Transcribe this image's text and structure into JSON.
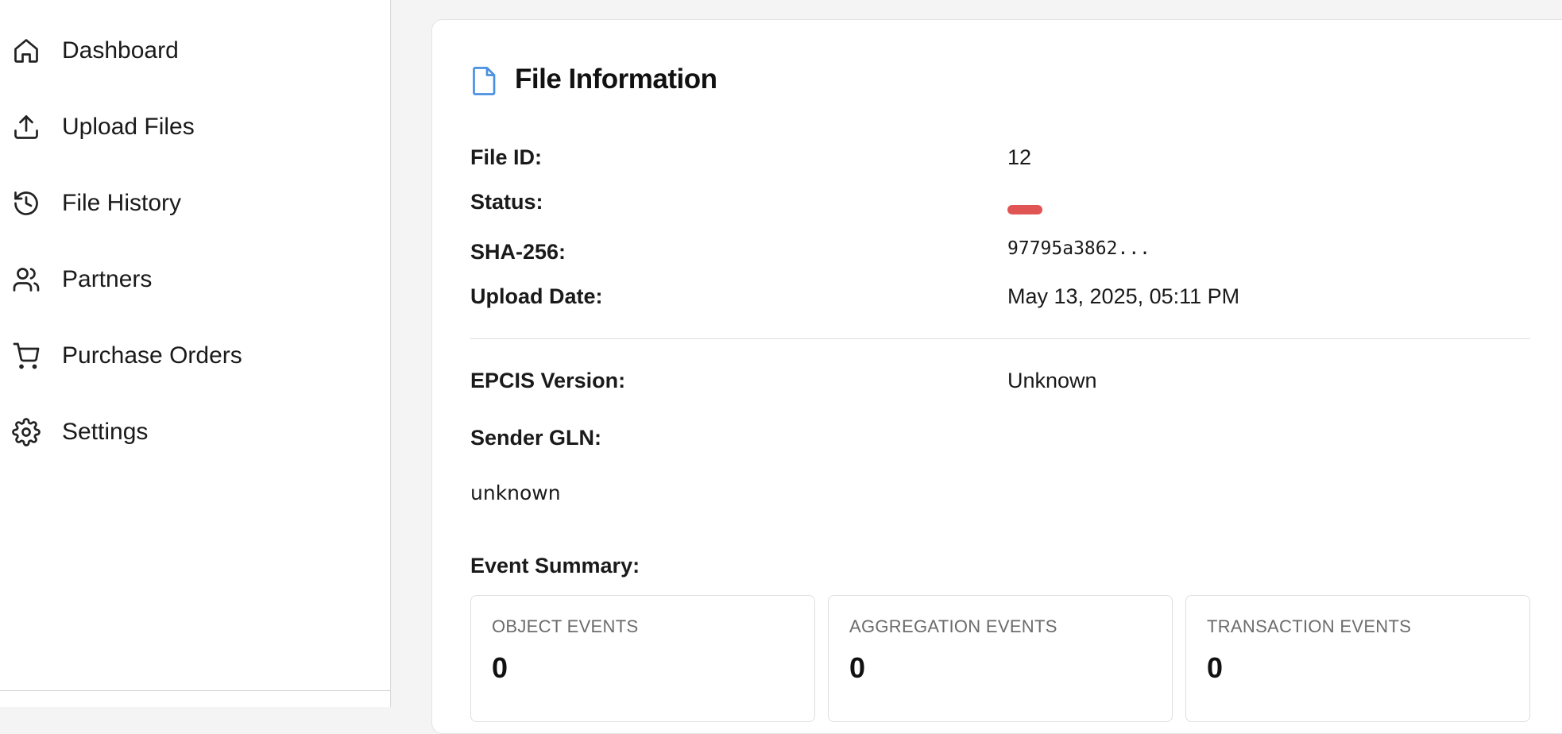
{
  "sidebar": {
    "items": [
      {
        "label": "Dashboard",
        "icon": "home-icon"
      },
      {
        "label": "Upload Files",
        "icon": "upload-icon"
      },
      {
        "label": "File History",
        "icon": "history-icon"
      },
      {
        "label": "Partners",
        "icon": "users-icon"
      },
      {
        "label": "Purchase Orders",
        "icon": "cart-icon"
      },
      {
        "label": "Settings",
        "icon": "gear-icon"
      }
    ]
  },
  "file_info": {
    "title": "File Information",
    "icon": "file-icon",
    "icon_color": "#4a90e2",
    "file_id_label": "File ID:",
    "file_id_value": "12",
    "status_label": "Status:",
    "status_color": "#e05454",
    "sha_label": "SHA-256:",
    "sha_value": "97795a3862...",
    "upload_date_label": "Upload Date:",
    "upload_date_value": "May 13, 2025, 05:11 PM",
    "epcis_label": "EPCIS Version:",
    "epcis_value": "Unknown",
    "sender_gln_label": "Sender GLN:",
    "sender_gln_value": "unknown",
    "event_summary_label": "Event Summary:",
    "events": [
      {
        "label": "OBJECT EVENTS",
        "count": "0"
      },
      {
        "label": "AGGREGATION EVENTS",
        "count": "0"
      },
      {
        "label": "TRANSACTION EVENTS",
        "count": "0"
      }
    ]
  }
}
